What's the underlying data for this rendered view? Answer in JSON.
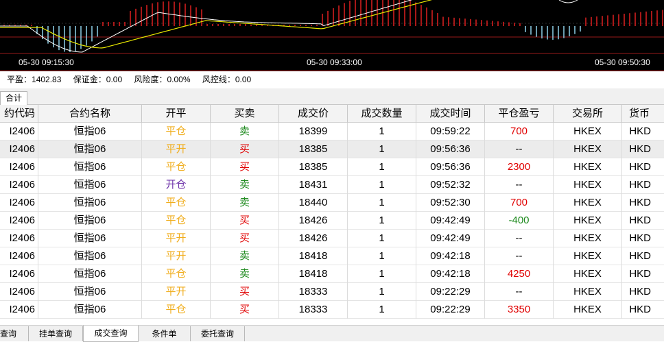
{
  "chart": {
    "time_labels": [
      "05-30 09:15:30",
      "05-30 09:33:00",
      "05-30 09:50:30"
    ]
  },
  "stats": {
    "pnl_label": "平盈：",
    "pnl_value": "1402.83",
    "margin_label": "保证金：",
    "margin_value": "0.00",
    "risk_label": "风险度：",
    "risk_value": "0.00%",
    "control_label": "风控线：",
    "control_value": "0.00"
  },
  "top_tab": {
    "label": "合计"
  },
  "table": {
    "headers": [
      "约代码",
      "合约名称",
      "开平",
      "买卖",
      "成交价",
      "成交数量",
      "成交时间",
      "平仓盈亏",
      "交易所",
      "货币"
    ],
    "rows": [
      {
        "code": "I2406",
        "name": "恒指06",
        "open_close": "平仓",
        "side": "卖",
        "price": "18399",
        "qty": "1",
        "time": "09:59:22",
        "pnl": "700",
        "exchange": "HKEX",
        "currency": "HKD"
      },
      {
        "code": "I2406",
        "name": "恒指06",
        "open_close": "平开",
        "side": "买",
        "price": "18385",
        "qty": "1",
        "time": "09:56:36",
        "pnl": "--",
        "exchange": "HKEX",
        "currency": "HKD"
      },
      {
        "code": "I2406",
        "name": "恒指06",
        "open_close": "平仓",
        "side": "买",
        "price": "18385",
        "qty": "1",
        "time": "09:56:36",
        "pnl": "2300",
        "exchange": "HKEX",
        "currency": "HKD"
      },
      {
        "code": "I2406",
        "name": "恒指06",
        "open_close": "开仓",
        "side": "卖",
        "price": "18431",
        "qty": "1",
        "time": "09:52:32",
        "pnl": "--",
        "exchange": "HKEX",
        "currency": "HKD"
      },
      {
        "code": "I2406",
        "name": "恒指06",
        "open_close": "平仓",
        "side": "卖",
        "price": "18440",
        "qty": "1",
        "time": "09:52:30",
        "pnl": "700",
        "exchange": "HKEX",
        "currency": "HKD"
      },
      {
        "code": "I2406",
        "name": "恒指06",
        "open_close": "平仓",
        "side": "买",
        "price": "18426",
        "qty": "1",
        "time": "09:42:49",
        "pnl": "-400",
        "exchange": "HKEX",
        "currency": "HKD"
      },
      {
        "code": "I2406",
        "name": "恒指06",
        "open_close": "平开",
        "side": "买",
        "price": "18426",
        "qty": "1",
        "time": "09:42:49",
        "pnl": "--",
        "exchange": "HKEX",
        "currency": "HKD"
      },
      {
        "code": "I2406",
        "name": "恒指06",
        "open_close": "平开",
        "side": "卖",
        "price": "18418",
        "qty": "1",
        "time": "09:42:18",
        "pnl": "--",
        "exchange": "HKEX",
        "currency": "HKD"
      },
      {
        "code": "I2406",
        "name": "恒指06",
        "open_close": "平仓",
        "side": "卖",
        "price": "18418",
        "qty": "1",
        "time": "09:42:18",
        "pnl": "4250",
        "exchange": "HKEX",
        "currency": "HKD"
      },
      {
        "code": "I2406",
        "name": "恒指06",
        "open_close": "平开",
        "side": "买",
        "price": "18333",
        "qty": "1",
        "time": "09:22:29",
        "pnl": "--",
        "exchange": "HKEX",
        "currency": "HKD"
      },
      {
        "code": "I2406",
        "name": "恒指06",
        "open_close": "平仓",
        "side": "买",
        "price": "18333",
        "qty": "1",
        "time": "09:22:29",
        "pnl": "3350",
        "exchange": "HKEX",
        "currency": "HKD"
      }
    ]
  },
  "bottom_tabs": [
    {
      "label": "查询"
    },
    {
      "label": "挂单查询"
    },
    {
      "label": "成交查询",
      "active": true
    },
    {
      "label": "条件单"
    },
    {
      "label": "委托查询"
    }
  ],
  "colors": {
    "gold": "#f0ad1c",
    "purple": "#6b2fa8",
    "green": "#1e8a1e",
    "red": "#e00000",
    "chart_bg": "#000000",
    "bar_red": "#e02020",
    "bar_cyan": "#8fd0e8",
    "line_white": "#ffffff",
    "line_yellow": "#e8e800",
    "grid_red": "#9a1a1a"
  }
}
